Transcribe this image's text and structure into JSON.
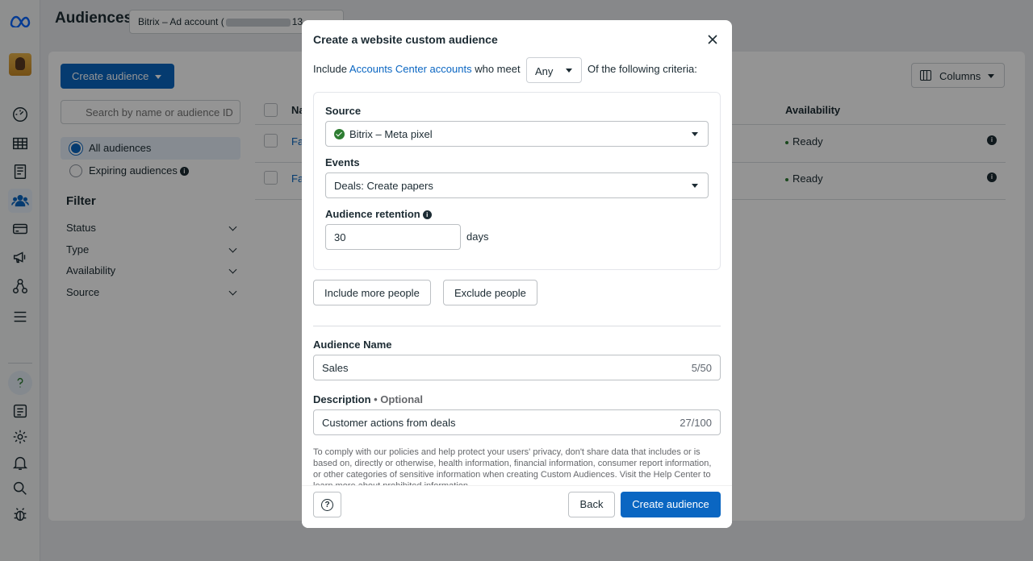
{
  "page": {
    "title": "Audiences",
    "account_prefix": "Bitrix – Ad account (",
    "account_suffix": "13",
    "create_button": "Create audience",
    "search_placeholder": "Search by name or audience ID",
    "segments": [
      "All audiences",
      "Expiring audiences"
    ],
    "filter_heading": "Filter",
    "filters": [
      "Status",
      "Type",
      "Availability",
      "Source"
    ],
    "columns_button": "Columns",
    "table": {
      "header_name": "Na",
      "header_availability": "Availability",
      "rows": [
        {
          "name": "Fa",
          "status": "Ready"
        },
        {
          "name": "Fa",
          "status": "Ready"
        }
      ]
    }
  },
  "modal": {
    "title": "Create a website custom audience",
    "include_prefix": "Include",
    "include_link": "Accounts Center accounts",
    "include_mid": "who meet",
    "match_value": "Any",
    "include_suffix": "Of the following criteria:",
    "source_label": "Source",
    "source_value": "Bitrix – Meta pixel",
    "events_label": "Events",
    "events_value": "Deals: Create papers",
    "retention_label": "Audience retention",
    "retention_value": "30",
    "retention_unit": "days",
    "include_more": "Include more people",
    "exclude": "Exclude people",
    "name_label": "Audience Name",
    "name_value": "Sales",
    "name_count": "5/50",
    "desc_label": "Description",
    "desc_optional": "• Optional",
    "desc_value": "Customer actions from deals",
    "desc_count": "27/100",
    "policy": "To comply with our policies and help protect your users' privacy, don't share data that includes or is based on, directly or otherwise, health information, financial information, consumer report information, or other categories of sensitive information when creating Custom Audiences. Visit the Help Center to learn more about prohibited information.",
    "back": "Back",
    "create": "Create audience"
  }
}
